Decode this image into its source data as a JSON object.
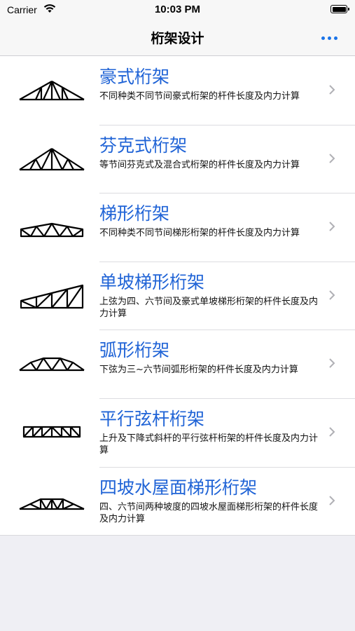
{
  "status_bar": {
    "carrier": "Carrier",
    "time": "10:03 PM"
  },
  "nav": {
    "title": "桁架设计",
    "more_icon": "ellipsis-icon",
    "accent_color": "#1a73e8"
  },
  "items": [
    {
      "title": "豪式桁架",
      "desc": "不同种类不同节间豪式桁架的杆件长度及内力计算",
      "icon": "howe-truss-icon"
    },
    {
      "title": "芬克式桁架",
      "desc": "等节间芬克式及混合式桁架的杆件长度及内力计算",
      "icon": "fink-truss-icon"
    },
    {
      "title": "梯形桁架",
      "desc": "不同种类不同节间梯形桁架的杆件长度及内力计算",
      "icon": "trapezoidal-truss-icon"
    },
    {
      "title": "单坡梯形桁架",
      "desc": "上弦为四、六节间及豪式单坡梯形桁架的杆件长度及内力计算",
      "icon": "mono-slope-truss-icon"
    },
    {
      "title": "弧形桁架",
      "desc": "下弦为三~六节间弧形桁架的杆件长度及内力计算",
      "icon": "arched-truss-icon"
    },
    {
      "title": "平行弦杆桁架",
      "desc": "上升及下降式斜杆的平行弦杆桁架的杆件长度及内力计算",
      "icon": "parallel-chord-truss-icon"
    },
    {
      "title": "四坡水屋面梯形桁架",
      "desc": "四、六节间两种坡度的四坡水屋面梯形桁架的杆件长度及内力计算",
      "icon": "hip-roof-truss-icon"
    }
  ],
  "chevron_icon": "chevron-right-icon"
}
